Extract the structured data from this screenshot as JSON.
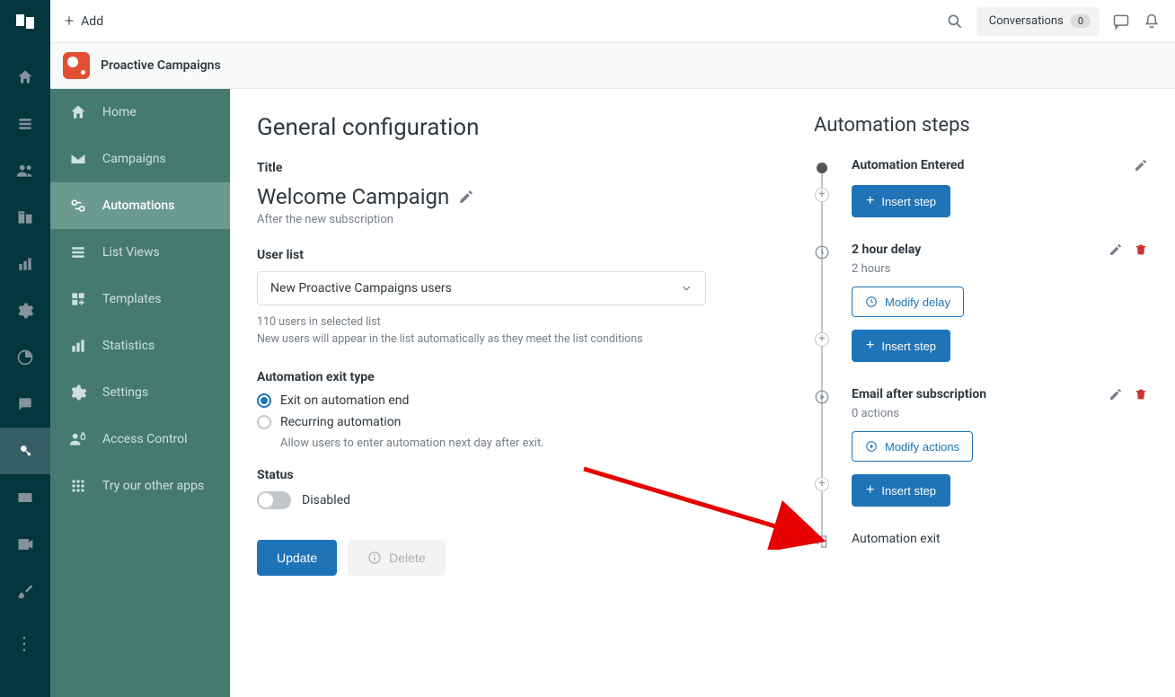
{
  "topbar": {
    "add_label": "Add",
    "conversations_label": "Conversations",
    "conversations_count": "0"
  },
  "app_header": {
    "title": "Proactive Campaigns"
  },
  "sidebar": {
    "items": [
      {
        "label": "Home"
      },
      {
        "label": "Campaigns"
      },
      {
        "label": "Automations"
      },
      {
        "label": "List Views"
      },
      {
        "label": "Templates"
      },
      {
        "label": "Statistics"
      },
      {
        "label": "Settings"
      },
      {
        "label": "Access Control"
      },
      {
        "label": "Try our other apps"
      }
    ],
    "active_index": 2
  },
  "config": {
    "page_title": "General configuration",
    "title_label": "Title",
    "title_value": "Welcome Campaign",
    "subtitle": "After the new subscription",
    "userlist_label": "User list",
    "userlist_value": "New Proactive Campaigns users",
    "userlist_helper_1": "110 users in selected list",
    "userlist_helper_2": "New users will appear in the list automatically as they meet the list conditions",
    "exit_label": "Automation exit type",
    "exit_opt1": "Exit on automation end",
    "exit_opt2": "Recurring automation",
    "exit_opt2_sub": "Allow users to enter automation next day after exit.",
    "status_label": "Status",
    "status_value": "Disabled",
    "update_btn": "Update",
    "delete_btn": "Delete"
  },
  "steps": {
    "heading": "Automation steps",
    "insert_label": "Insert step",
    "entered": {
      "title": "Automation Entered"
    },
    "delay": {
      "title": "2 hour delay",
      "sub": "2 hours",
      "modify": "Modify delay"
    },
    "email": {
      "title": "Email after subscription",
      "sub": "0 actions",
      "modify": "Modify actions"
    },
    "exit": {
      "title": "Automation exit"
    }
  }
}
